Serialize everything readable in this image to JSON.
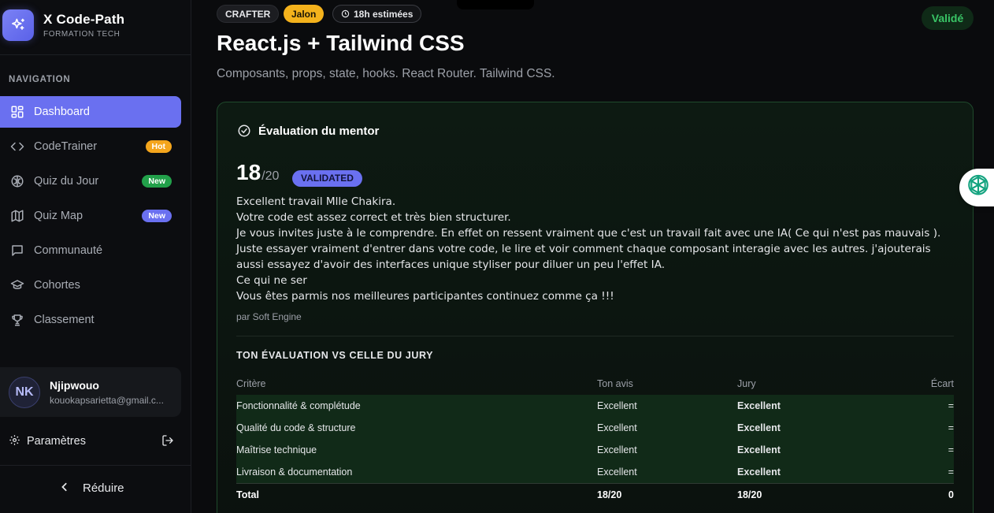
{
  "brand": {
    "title": "X Code-Path",
    "subtitle": "FORMATION TECH"
  },
  "nav": {
    "heading": "NAVIGATION",
    "items": [
      {
        "label": "Dashboard",
        "icon": "dashboard-icon",
        "active": true
      },
      {
        "label": "CodeTrainer",
        "icon": "code-icon",
        "badge": "Hot"
      },
      {
        "label": "Quiz du Jour",
        "icon": "brain-icon",
        "badge": "New"
      },
      {
        "label": "Quiz Map",
        "icon": "map-icon",
        "badge": "New"
      },
      {
        "label": "Communauté",
        "icon": "message-icon"
      },
      {
        "label": "Cohortes",
        "icon": "graduation-cap-icon"
      },
      {
        "label": "Classement",
        "icon": "trophy-icon"
      }
    ]
  },
  "user": {
    "initials": "NK",
    "name": "Njipwouo",
    "email": "kouokapsarietta@gmail.c..."
  },
  "footer": {
    "settings_label": "Paramètres",
    "reduce_label": "Réduire"
  },
  "header": {
    "chips": {
      "level": "CRAFTER",
      "type": "Jalon",
      "duration": "18h estimées"
    },
    "status": "Validé",
    "title": "React.js + Tailwind CSS",
    "subtitle": "Composants, props, state, hooks. React Router. Tailwind CSS."
  },
  "evaluation": {
    "heading": "Évaluation du mentor",
    "score": "18",
    "score_max": "/20",
    "status_badge": "VALIDATED",
    "feedback_lines": [
      "Excellent travail Mlle Chakira.",
      "Votre code est assez correct et très bien structurer.",
      "Je vous invites juste à le comprendre. En effet on ressent vraiment que c'est un travail fait avec une IA( Ce qui n'est pas mauvais ). Juste essayer vraiment d'entrer dans votre code, le lire et voir comment chaque composant interagie avec les autres. j'ajouterais aussi essayez d'avoir des interfaces unique styliser pour diluer un peu l'effet IA.",
      "Ce qui ne ser",
      "Vous êtes parmis nos meilleures participantes continuez comme ça !!!"
    ],
    "byline": "par Soft Engine"
  },
  "comparison": {
    "title": "TON ÉVALUATION VS CELLE DU JURY",
    "columns": {
      "criterion": "Critère",
      "self": "Ton avis",
      "jury": "Jury",
      "gap": "Écart"
    },
    "rows": [
      {
        "criterion": "Fonctionnalité & complétude",
        "self": "Excellent",
        "jury": "Excellent",
        "gap": "="
      },
      {
        "criterion": "Qualité du code & structure",
        "self": "Excellent",
        "jury": "Excellent",
        "gap": "="
      },
      {
        "criterion": "Maîtrise technique",
        "self": "Excellent",
        "jury": "Excellent",
        "gap": "="
      },
      {
        "criterion": "Livraison & documentation",
        "self": "Excellent",
        "jury": "Excellent",
        "gap": "="
      }
    ],
    "total": {
      "label": "Total",
      "self": "18/20",
      "jury": "18/20",
      "gap": "0"
    }
  },
  "colors": {
    "accent": "#6a70f0",
    "success": "#39c466",
    "hot": "#f4a51c",
    "new_green": "#22a04a"
  }
}
